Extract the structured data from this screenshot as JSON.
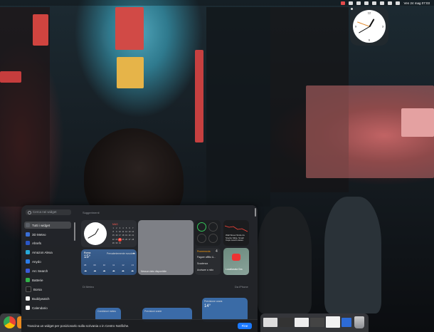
{
  "menubar": {
    "datetime": "Ven 24 mag 07:03"
  },
  "gallery": {
    "search_placeholder": "Cerca nei widget",
    "sidebar_items": [
      {
        "label": "Tutti i widget",
        "icon": "widgets-icon",
        "color": "#4a4d52"
      },
      {
        "label": "3D Meteo",
        "icon": "3d-meteo-icon",
        "color": "#3a6fd6"
      },
      {
        "label": "Ahrefs",
        "icon": "ahrefs-icon",
        "color": "#2a56c6"
      },
      {
        "label": "Amazon Alexa",
        "icon": "alexa-icon",
        "color": "#27a8d8"
      },
      {
        "label": "Anydo",
        "icon": "anydo-icon",
        "color": "#2b7de9"
      },
      {
        "label": "Arc Search",
        "icon": "arc-search-icon",
        "color": "#3b5cd9"
      },
      {
        "label": "Batterie",
        "icon": "battery-icon",
        "color": "#32b34a"
      },
      {
        "label": "Borsa",
        "icon": "stocks-icon",
        "color": "#1c1c1e"
      },
      {
        "label": "Buddywatch",
        "icon": "buddywatch-icon",
        "color": "#f4f4f4"
      },
      {
        "label": "Calendario",
        "icon": "calendar-icon",
        "color": "#ffffff"
      }
    ],
    "section_suggested": "Suggerimenti",
    "section_2": "Di Meteo",
    "section_2_right": "Da iPhone",
    "calendar": {
      "month": "MAG",
      "days": [
        "1",
        "2",
        "3",
        "4",
        "5",
        "6",
        "7",
        "8",
        "9",
        "10",
        "11",
        "12",
        "13",
        "14",
        "15",
        "16",
        "17",
        "18",
        "19",
        "20",
        "21",
        "22",
        "23",
        "24",
        "25",
        "26",
        "27",
        "28",
        "29",
        "30",
        "31"
      ]
    },
    "weather": {
      "city": "Roma",
      "temp": "15°",
      "desc": "Prevalentemente nuvoloso",
      "hours": [
        "08",
        "09",
        "10",
        "11",
        "12",
        "13"
      ]
    },
    "placeholder_caption": "Nessun dato disponibile",
    "reminder": {
      "title": "Promemoria",
      "count": "4",
      "items": [
        "Pagare affitto &...",
        "Scadenza",
        "Avvisare a nido"
      ]
    },
    "stocks_news": {
      "headline": "Wall Street Sinks As Stocks Slide, Small Caps Lead Losses"
    },
    "find_my": {
      "label": "Localizzata Ora"
    },
    "bottom_row": [
      {
        "label": "Condizioni meteo"
      },
      {
        "label": "Previsioni orarie"
      },
      {
        "label": "Previsione oraria",
        "temp": "14°"
      }
    ],
    "hint": "Trascina un widget per posizionarlo sulla scrivania o in Centro Notifiche.",
    "done_label": "Fine"
  },
  "colors": {
    "accent": "#1a79ff"
  }
}
